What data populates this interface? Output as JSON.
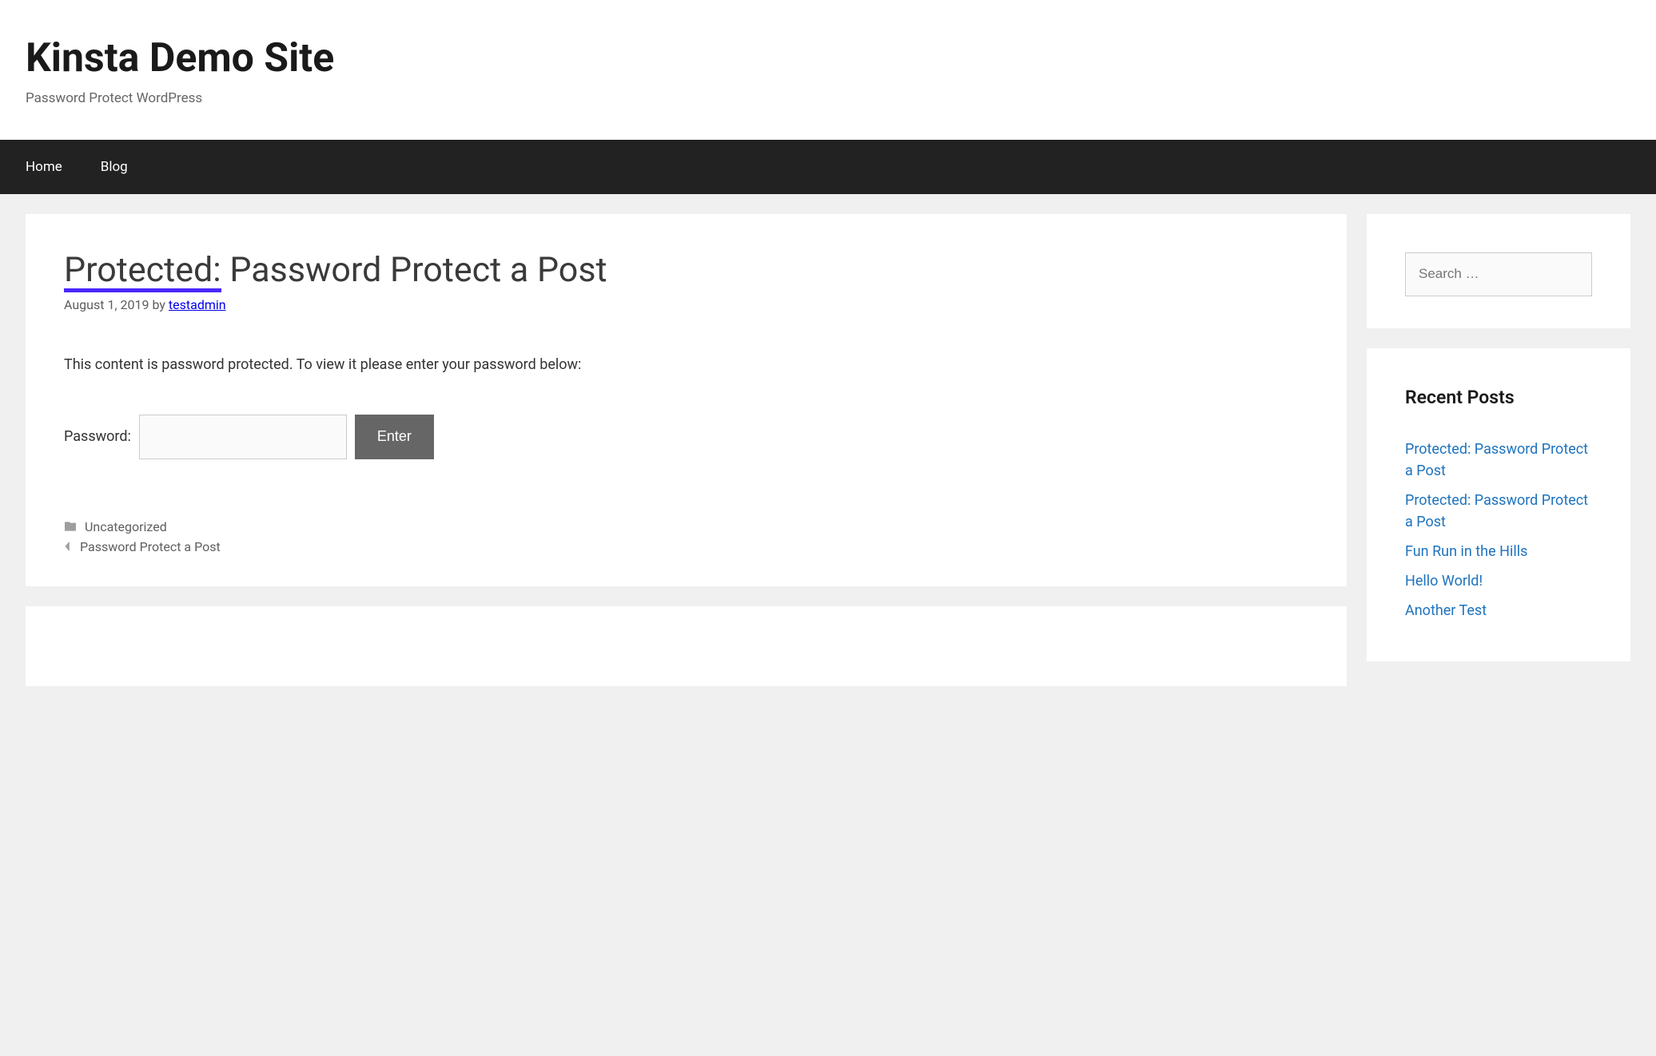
{
  "header": {
    "site_title": "Kinsta Demo Site",
    "tagline": "Password Protect WordPress"
  },
  "nav": {
    "items": [
      "Home",
      "Blog"
    ]
  },
  "post": {
    "title_prefix": "Protected:",
    "title_rest": " Password Protect a Post",
    "date": "August 1, 2019",
    "by_label": " by ",
    "author": "testadmin",
    "protected_msg": "This content is password protected. To view it please enter your password below:",
    "pw_label": "Password:",
    "pw_value": "",
    "pw_button": "Enter",
    "category": "Uncategorized",
    "nav_prev": "Password Protect a Post"
  },
  "sidebar": {
    "search_placeholder": "Search …",
    "recent_title": "Recent Posts",
    "recent_posts": [
      "Protected: Password Protect a Post",
      "Protected: Password Protect a Post",
      "Fun Run in the Hills",
      "Hello World!",
      "Another Test"
    ]
  }
}
